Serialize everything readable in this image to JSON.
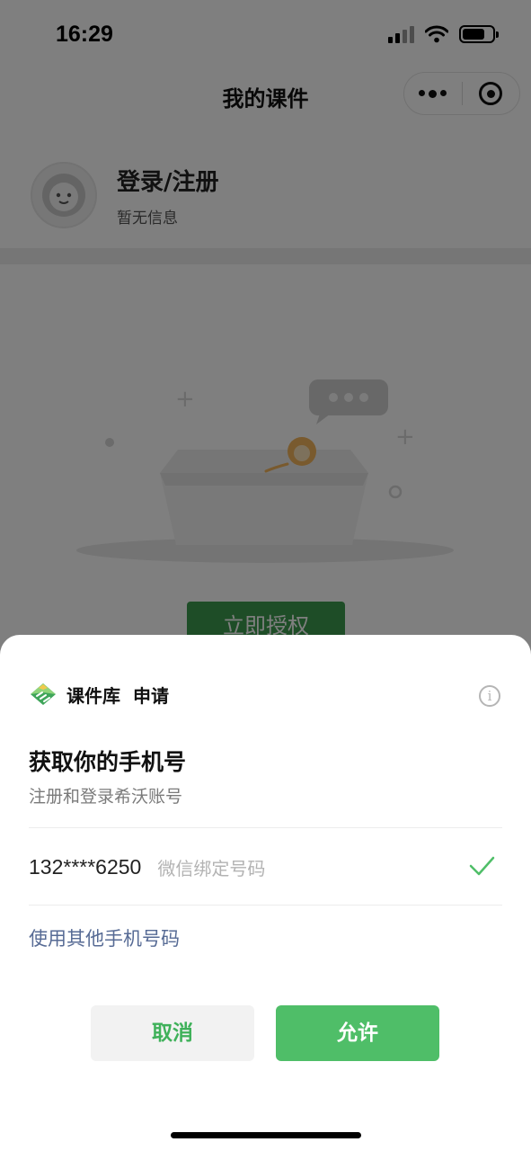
{
  "status_bar": {
    "time": "16:29"
  },
  "nav": {
    "title": "我的课件",
    "more_icon": "more-dots-icon",
    "close_icon": "target-icon"
  },
  "profile": {
    "name": "登录/注册",
    "subtitle": "暂无信息"
  },
  "main": {
    "auth_button": "立即授权"
  },
  "sheet": {
    "app_name": "课件库",
    "action": "申请",
    "info_glyph": "i",
    "title": "获取你的手机号",
    "subtitle": "注册和登录希沃账号",
    "phone": {
      "number": "132****6250",
      "note": "微信绑定号码",
      "selected": true
    },
    "other_link": "使用其他手机号码",
    "cancel_label": "取消",
    "allow_label": "允许"
  },
  "colors": {
    "accent_green": "#4fbe68",
    "link_blue": "#576b95",
    "overlay": "rgba(0,0,0,0.5)"
  }
}
